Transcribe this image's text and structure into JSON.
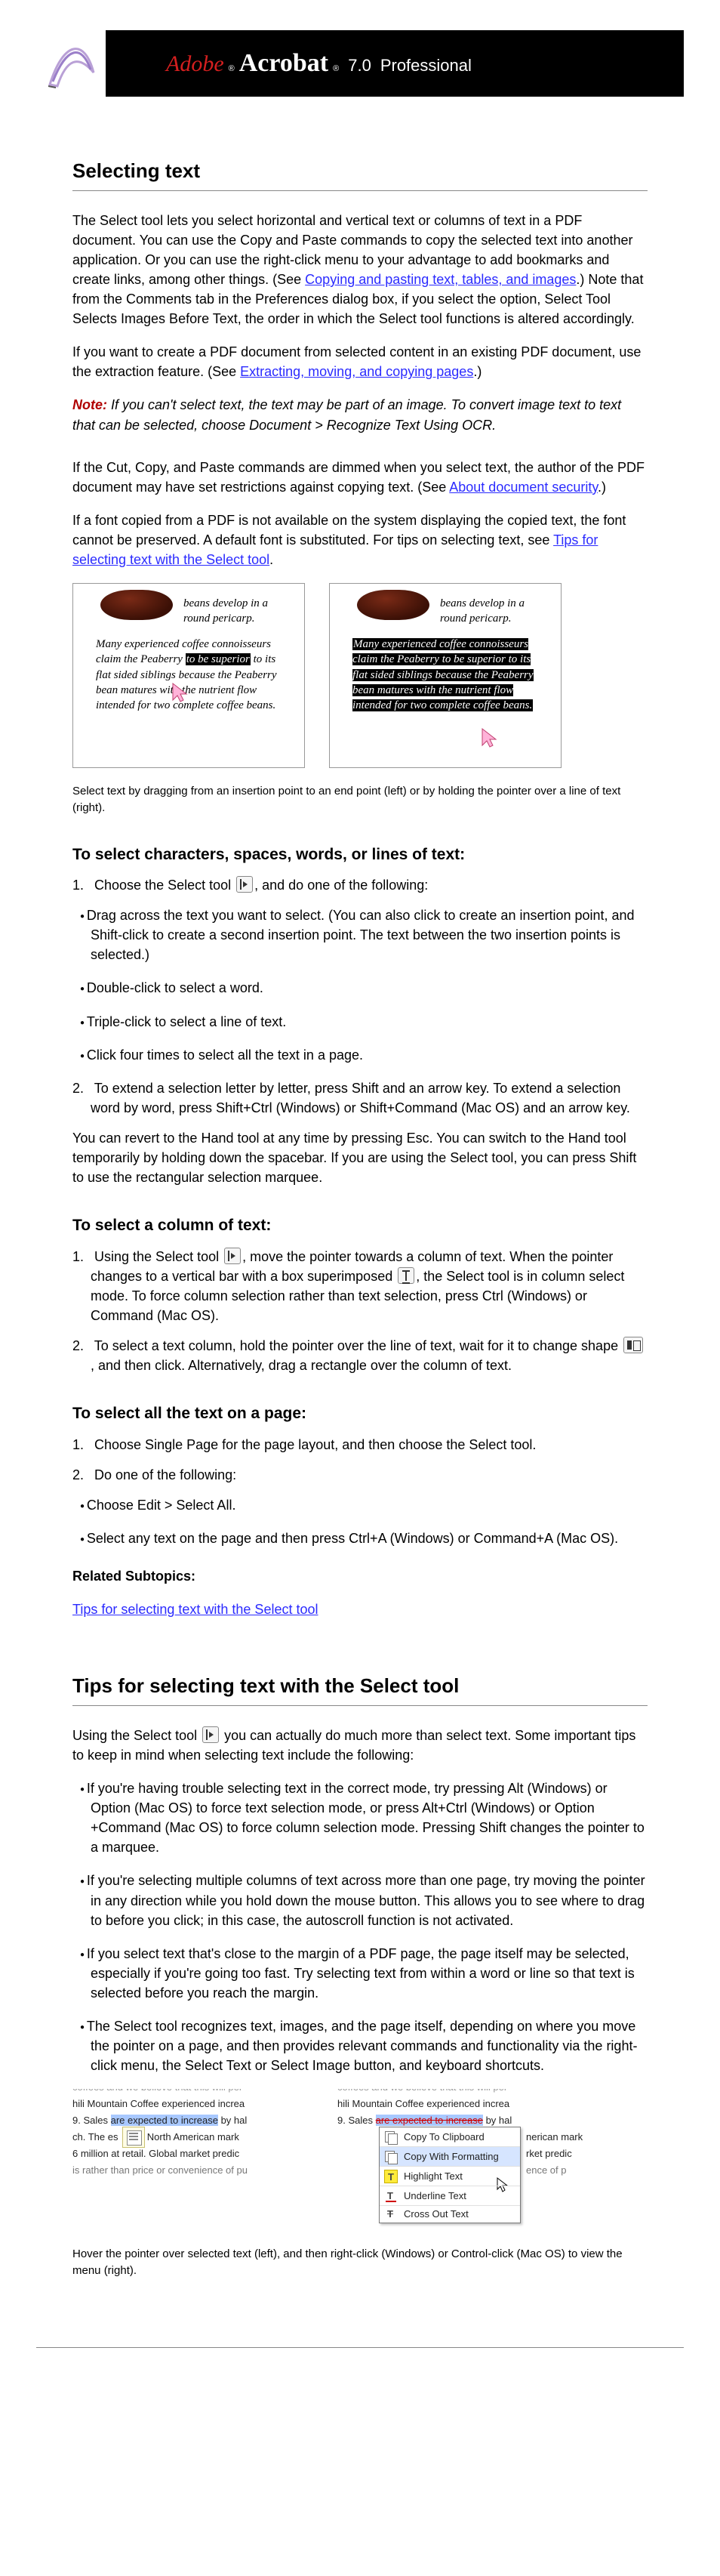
{
  "header": {
    "adobe": "Adobe",
    "acrobat": "Acrobat",
    "version": "7.0",
    "pro": "Professional"
  },
  "section1": {
    "title": "Selecting text",
    "p1a": "The Select tool lets you select horizontal and vertical text or columns of text in a PDF document. You can use the Copy and Paste commands to copy the selected text into another application. Or you can use the right-click menu to your advantage to add bookmarks and create links, among other things. (See ",
    "link1": "Copying and pasting text, tables, and images",
    "p1b": ".) Note that from the Comments tab in the Preferences dialog box, if you select the option, Select Tool Selects Images Before Text, the order in which the Select tool functions is altered accordingly.",
    "p2a": "If you want to create a PDF document from selected content in an existing PDF document, use the extraction feature. (See ",
    "link2": "Extracting, moving, and copying pages",
    "p2b": ".)",
    "note_label": "Note:",
    "note": " If you can't select text, the text may be part of an image. To convert image text to text that can be selected, choose Document > Recognize Text Using OCR.",
    "p3a": "If the Cut, Copy, and Paste commands are dimmed when you select text, the author of the PDF document may have set restrictions against copying text. (See ",
    "link3": "About document security",
    "p3b": ".)",
    "p4a": "If a font copied from a PDF is not available on the system displaying the copied text, the font cannot be preserved. A default font is substituted. For tips on selecting text, see ",
    "link4": "Tips for selecting text with the Select tool",
    "p4b": ".",
    "fig_a1": "beans develop in a round pericarp.",
    "fig_a2a": "Many experienced coffee connoisseurs claim the Peaberry ",
    "fig_a2_hl": "to be superior",
    "fig_a2b": " to its flat sided siblings because the Peaberry bean matures with the nutrient flow intended for two complete coffee beans.",
    "fig_b1": "beans develop in a round pericarp.",
    "fig_b2": "Many experienced coffee connoisseurs claim the Peaberry to be superior to its flat sided siblings because the Peaberry bean matures with the nutrient flow intended for two complete coffee beans.",
    "caption": "Select text by dragging from an insertion point to an end point (left) or by holding the pointer over a line of text (right).",
    "h3_1": "To select characters, spaces, words, or lines of text:",
    "s1_a": "Choose the Select tool ",
    "s1_b": ", and do one of the following:",
    "b1": "Drag across the text you want to select. (You can also click to create an insertion point, and Shift-click to create a second insertion point. The text between the two insertion points is selected.)",
    "b2": "Double-click to select a word.",
    "b3": "Triple-click to select a line of text.",
    "b4": "Click four times to select all the text in a page.",
    "s2": "To extend a selection letter by letter, press Shift and an arrow key. To extend a selection word by word, press Shift+Ctrl (Windows) or Shift+Command (Mac OS) and an arrow key.",
    "p_last": "You can revert to the Hand tool at any time by pressing Esc. You can switch to the Hand tool temporarily by holding down the spacebar. If you are using the Select tool, you can press Shift to use the rectangular selection marquee.",
    "h3_2": "To select a column of text:",
    "s2_1a": "Using the Select tool ",
    "s2_1b": ", move the pointer towards a column of text. When the pointer changes to a vertical bar with a box superimposed ",
    "s2_1c": ", the Select tool is in column select mode. To force column selection rather than text selection, press Ctrl (Windows) or Command (Mac OS).",
    "s2_2a": "To select a text column, hold the pointer over the line of text, wait for it to change shape ",
    "s2_2b": ", and then click. Alternatively, drag a rectangle over the column of text.",
    "h3_3": "To select all the text on a page:",
    "s3_1": "Choose Single Page for the page layout, and then choose the Select tool.",
    "s3_2": "Do one of the following:",
    "b3_1": "Choose Edit > Select All.",
    "b3_2": "Select any text on the page and then press Ctrl+A (Windows) or Command+A (Mac OS).",
    "rs": "Related Subtopics:",
    "rs_link": "Tips for selecting text with the Select tool"
  },
  "section2": {
    "title": "Tips for selecting text with the Select tool",
    "p1a": "Using the Select tool ",
    "p1b": " you can actually do much more than select text. Some important tips to keep in mind when selecting text include the following:",
    "b1": "If you're having trouble selecting text in the correct mode, try pressing Alt (Windows) or Option (Mac OS) to force text selection mode, or press Alt+Ctrl (Windows) or Option +Command (Mac OS) to force column selection mode. Pressing Shift changes the pointer to a marquee.",
    "b2": "If you're selecting multiple columns of text across more than one page, try moving the pointer in any direction while you hold down the mouse button. This allows you to see where to drag to before you click; in this case, the autoscroll function is not activated.",
    "b3": "If you select text that's close to the margin of a PDF page, the page itself may be selected, especially if you're going too fast. Try selecting text from within a word or line so that text is selected before you reach the margin.",
    "b4": "The Select tool recognizes text, images, and the page itself, depending on where you move the pointer on a page, and then provides relevant commands and functionality via the right-click menu, the Select Text or Select Image button, and keyboard shortcuts.",
    "fig_lines": {
      "a": "coffees and we believe that this will per",
      "b": "hili Mountain Coffee experienced increa",
      "c_pre": "9. Sales ",
      "c_sel": "are expected to increase",
      "c_post": " by hal",
      "d_pre": "ch. The es",
      "d_post": " North American mark",
      "d_right": "nerican mark",
      "e": "6 million at retail. Global market predic",
      "e_right": "rket predic",
      "f": "is rather than price or convenience of pu",
      "f_right": "ence of p"
    },
    "menu": {
      "m1": "Copy To Clipboard",
      "m2": "Copy With Formatting",
      "m3": "Highlight Text",
      "m4": "Underline Text",
      "m5": "Cross Out Text"
    },
    "caption2": "Hover the pointer over selected text (left), and then right-click (Windows) or Control-click (Mac OS) to view the menu (right)."
  }
}
